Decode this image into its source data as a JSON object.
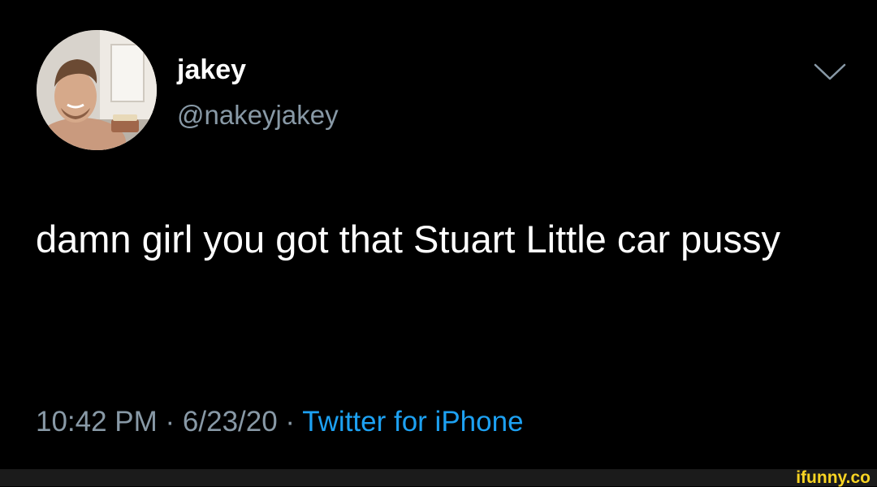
{
  "user": {
    "display_name": "jakey",
    "handle": "@nakeyjakey",
    "avatar_icon": "user-avatar-photo"
  },
  "tweet": {
    "text": "damn girl you got that Stuart Little car pussy"
  },
  "meta": {
    "time": "10:42 PM",
    "separator": " · ",
    "date": "6/23/20",
    "source": "Twitter for iPhone"
  },
  "menu": {
    "icon": "chevron-down-icon"
  },
  "watermark": {
    "text": "ifunny.co"
  },
  "colors": {
    "background": "#000000",
    "text_primary": "#ffffff",
    "text_secondary": "#8899a6",
    "link": "#1da1f2",
    "watermark": "#f9d423",
    "watermark_bar": "#1b1b1b"
  }
}
